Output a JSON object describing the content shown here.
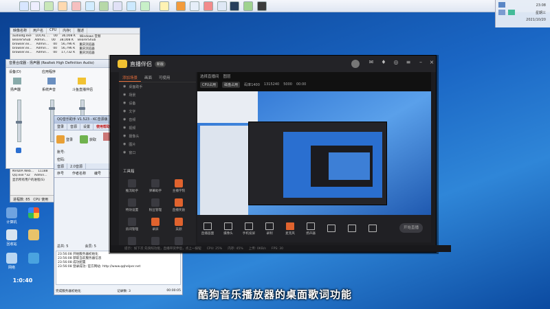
{
  "topbar": {
    "tray_time": "23:08",
    "tray_day": "星期三",
    "tray_date": "2021/10/20"
  },
  "taskmgr": {
    "headers": [
      "映像名称",
      "用户名",
      "CPU",
      "内存(",
      "描述"
    ],
    "rows": [
      [
        "audiodg.exe",
        "LOCAL ...",
        "00",
        "36,008 K",
        "Windows 音频"
      ],
      [
        "BearerShub",
        "Admin...",
        "00",
        "38,008 K",
        "BearerShub"
      ],
      [
        "browser.ex...",
        "Admin...",
        "00",
        "56,796 K",
        "重庆浏览器"
      ],
      [
        "browser.ex...",
        "Admin...",
        "00",
        "56,796 K",
        "重庆浏览器"
      ],
      [
        "browser.ex...",
        "Admin...",
        "00",
        "17,732 K",
        "重庆浏览器"
      ],
      [
        "NVDisplay",
        "11188",
        "",
        "",
        ""
      ],
      [
        "NVIDIA Web...",
        "11188",
        "",
        "",
        ""
      ],
      [
        "QQ.exe *32",
        "Admin...",
        "",
        "",
        ""
      ]
    ],
    "checkbox_label": "显示所有用户的进程(S)",
    "status_processes": "进程数: 85",
    "status_cpu": "CPU 使用"
  },
  "mixer": {
    "title": "音量合成器 - 扬声器 (Realtek High Definition Audio)",
    "group_device": "设备(D)",
    "group_apps": "应用程序",
    "ch_speaker": "扬声器",
    "ch_system": "系统声音",
    "ch_recorder": "斗鱼直播伴侣",
    "ch_more": "..."
  },
  "qq": {
    "title": "QQ音乐助手 V1.523 - KC音源版",
    "tabs": [
      "登录",
      "音源",
      "设置",
      "使用帮助"
    ],
    "tab_highlight": "使用帮助",
    "icon_labels": [
      "登录",
      "获取",
      ""
    ],
    "field_user": "账号:",
    "field_pwd": "密码:",
    "sub_tabs": [
      "音源",
      "2.0音源"
    ],
    "list_headers": [
      "序号",
      "作者名称",
      "编号",
      "会员"
    ],
    "counter_total": "总共: 5",
    "counter_member": "会员: 5",
    "log": [
      "23:56:08  开始服务器初始化",
      "23:56:08  获取当前服务器信息",
      "23:56:08  成功配置",
      "23:56:08  登录成功: 官方网站: http://www.qqhelper.net"
    ],
    "footer_status": "完成服务器初始化",
    "footer_count": "记录数: 3",
    "footer_time": "00:00:05"
  },
  "recorder": {
    "app_name": "直播伴侣",
    "badge": "新版",
    "left_tabs": [
      "添加场景",
      "画面",
      "可使用"
    ],
    "sources": [
      "桌面助手",
      "场景",
      "设备",
      "文字",
      "音频",
      "视频",
      "摄像头",
      "图片",
      "窗口"
    ],
    "tools_title": "工具箱",
    "tools": [
      {
        "label": "推流助手",
        "hot": false
      },
      {
        "label": "弹幕助手",
        "hot": false
      },
      {
        "label": "主播学院",
        "hot": true
      },
      {
        "label": "特效设置",
        "hot": false
      },
      {
        "label": "粉丝管理",
        "hot": false
      },
      {
        "label": "直播奖励",
        "hot": true
      },
      {
        "label": "房间管理",
        "hot": false
      },
      {
        "label": "录屏",
        "hot": true
      },
      {
        "label": "美颜",
        "hot": true
      },
      {
        "label": "连麦",
        "hot": false
      },
      {
        "label": "更多",
        "hot": false
      },
      {
        "label": "设置",
        "hot": false
      }
    ],
    "preview_tabs": [
      "选择直播间",
      "图层"
    ],
    "preview_info": [
      "CPU占用",
      "磁盘占用",
      "码率1400",
      "1315240",
      "5000",
      "00:00"
    ],
    "bottom_buttons": [
      {
        "label": "直播画面",
        "red": false
      },
      {
        "label": "摄像头",
        "red": false
      },
      {
        "label": "手机投屏",
        "red": false
      },
      {
        "label": "录制",
        "red": false
      },
      {
        "label": "麦克风",
        "red": true
      },
      {
        "label": "扬声器",
        "red": false
      },
      {
        "label": "",
        "red": false
      },
      {
        "label": "",
        "red": false
      },
      {
        "label": "",
        "red": false
      }
    ],
    "start_label": "开始直播",
    "status_line": "提示: 点击更多功能",
    "statusbar": [
      "CPU: 25%",
      "内存: 45%",
      "上传: 0KB/s",
      "FPS: 30"
    ],
    "tip_text": "提示：如下次 先快照功能，直播带货伴侣，点上一按钮"
  },
  "desktop_icons": [
    "计算机",
    "回收站",
    "网络",
    "",
    "",
    "",
    ""
  ],
  "desktop_clock": "1:0:40",
  "caption": "酷狗音乐播放器的桌面歌词功能"
}
